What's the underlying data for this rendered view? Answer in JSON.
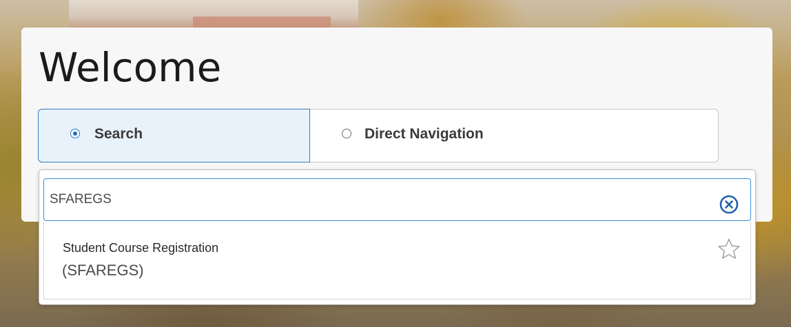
{
  "page": {
    "title": "Welcome"
  },
  "mode_selector": {
    "options": [
      {
        "label": "Search",
        "selected": true
      },
      {
        "label": "Direct Navigation",
        "selected": false
      }
    ]
  },
  "search": {
    "value": "SFAREGS",
    "clear_icon": "circle-x-icon",
    "results": [
      {
        "name": "Student Course Registration",
        "code": "(SFAREGS)",
        "favorite": false,
        "favorite_icon": "star-outline-icon"
      }
    ]
  },
  "colors": {
    "accent": "#2e7bc6",
    "selected_bg": "#e8f2fb",
    "card_bg": "#f7f7f7",
    "text": "#1b1b1b",
    "clear_icon": "#1f5fae"
  }
}
